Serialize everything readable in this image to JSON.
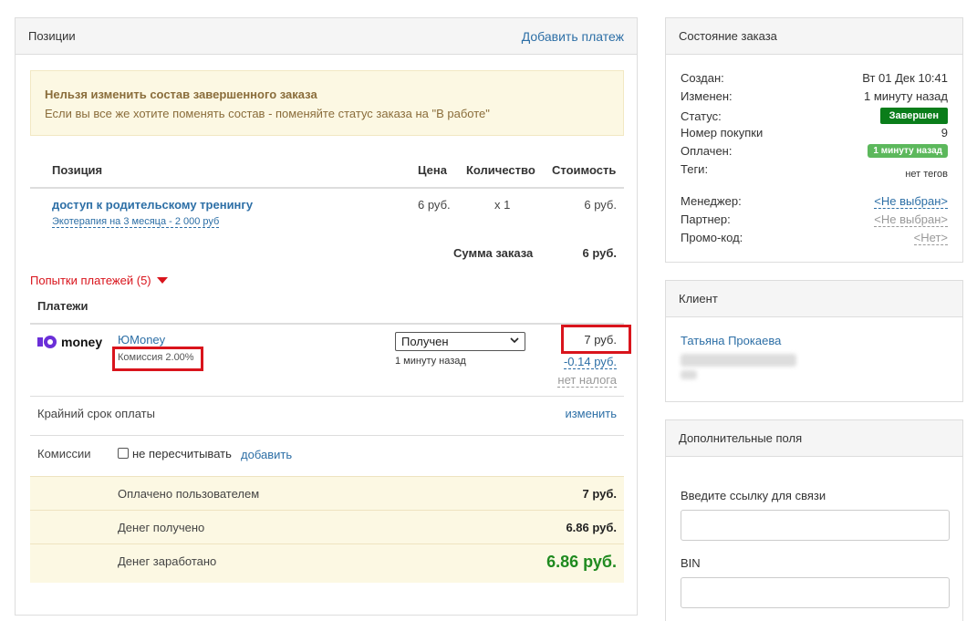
{
  "positions": {
    "title": "Позиции",
    "add_payment": "Добавить платеж",
    "notice_title": "Нельзя изменить состав завершенного заказа",
    "notice_text": "Если вы все же хотите поменять состав - поменяйте статус заказа на \"В работе\"",
    "headers": {
      "position": "Позиция",
      "price": "Цена",
      "qty": "Количество",
      "cost": "Стоимость"
    },
    "item": {
      "name": "доступ к родительскому тренингу",
      "variant": "Экотерапия на 3 месяца - 2 000 руб",
      "price": "6 руб.",
      "qty": "x 1",
      "cost": "6 руб."
    },
    "total_label": "Сумма заказа",
    "total_value": "6 руб.",
    "attempts": "Попытки платежей (5)",
    "payments_title": "Платежи",
    "payment": {
      "logo": "money",
      "provider": "ЮMoney",
      "commission": "Комиссия 2.00%",
      "status": "Получен",
      "time": "1 минуту назад",
      "amount": "7 руб.",
      "fee": "-0.14 руб.",
      "tax": "нет налога"
    },
    "deadline_label": "Крайний срок оплаты",
    "deadline_action": "изменить",
    "commissions_label": "Комиссии",
    "no_recalc": "не пересчитывать",
    "add": "добавить",
    "summary": [
      {
        "label": "Оплачено пользователем",
        "value": "7 руб."
      },
      {
        "label": "Денег получено",
        "value": "6.86 руб."
      },
      {
        "label": "Денег заработано",
        "value": "6.86 руб."
      }
    ]
  },
  "status_panel": {
    "title": "Состояние заказа",
    "created_label": "Создан:",
    "created_value": "Вт 01 Дек 10:41",
    "changed_label": "Изменен:",
    "changed_value": "1 минуту назад",
    "status_label": "Статус:",
    "status_value": "Завершен",
    "number_label": "Номер покупки",
    "number_value": "9",
    "paid_label": "Оплачен:",
    "paid_value": "1 минуту назад",
    "tags_label": "Теги:",
    "tags_value": "нет тегов",
    "manager_label": "Менеджер:",
    "manager_value": "<Не выбран>",
    "partner_label": "Партнер:",
    "partner_value": "<Не выбран>",
    "promo_label": "Промо-код:",
    "promo_value": "<Нет>"
  },
  "client_panel": {
    "title": "Клиент",
    "name": "Татьяна Прокаева"
  },
  "fields_panel": {
    "title": "Дополнительные поля",
    "link_label": "Введите ссылку для связи",
    "bin_label": "BIN"
  },
  "colors": {
    "link": "#2d6fa6",
    "status_green": "#0a7d1a",
    "paid_green": "#5cb85c",
    "earned_green": "#1f8a1f",
    "alert_red": "#d9141c"
  }
}
